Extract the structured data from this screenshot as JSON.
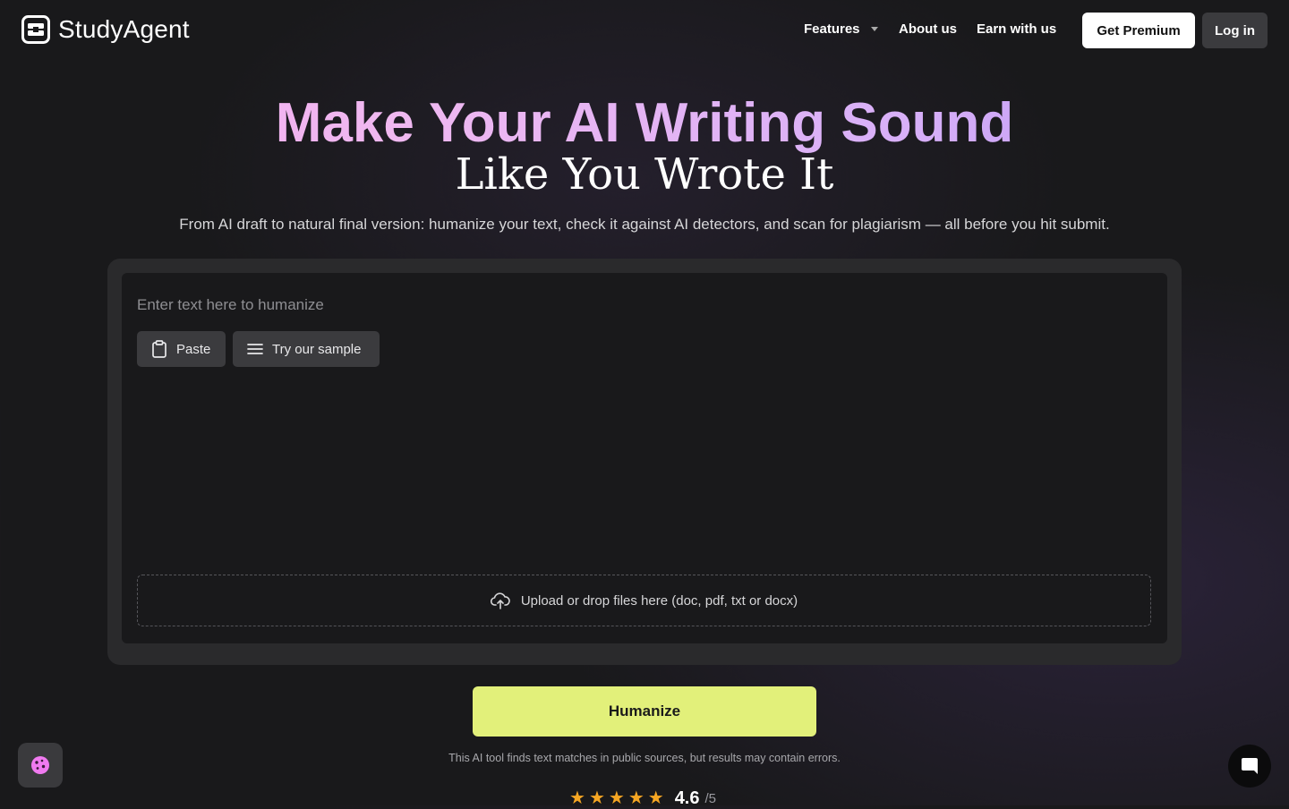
{
  "nav": {
    "brand": "StudyAgent",
    "features": "Features",
    "about": "About us",
    "earn": "Earn with us",
    "premium": "Get Premium",
    "login": "Log in"
  },
  "hero": {
    "title": "Make Your AI Writing Sound",
    "title_line2": "Like You Wrote It",
    "subtitle": "From AI draft to natural final version: humanize your text, check it against AI detectors, and scan for plagiarism — all before you hit submit."
  },
  "editor": {
    "placeholder": "Enter text here to humanize",
    "paste_label": "Paste",
    "sample_label": "Try our sample",
    "upload_label": "Upload or drop files here (doc, pdf, txt or docx)"
  },
  "actions": {
    "humanize_label": "Humanize",
    "disclaimer": "This AI tool finds text matches in public sources, but results may contain errors."
  },
  "rating": {
    "value": "4.6",
    "max": "/5",
    "stars": 5
  },
  "colors": {
    "accent": "#e2f07a",
    "title_gradient_start": "#f4a8ee",
    "title_gradient_end": "#b493f4",
    "star": "#f5a623"
  },
  "icons": {
    "logo": "studyagent-logo-icon",
    "features_caret": "chevron-down-icon",
    "paste": "clipboard-icon",
    "sample": "menu-lines-icon",
    "upload": "cloud-upload-icon",
    "cookie": "cookie-icon",
    "chat": "chat-bubble-icon"
  }
}
